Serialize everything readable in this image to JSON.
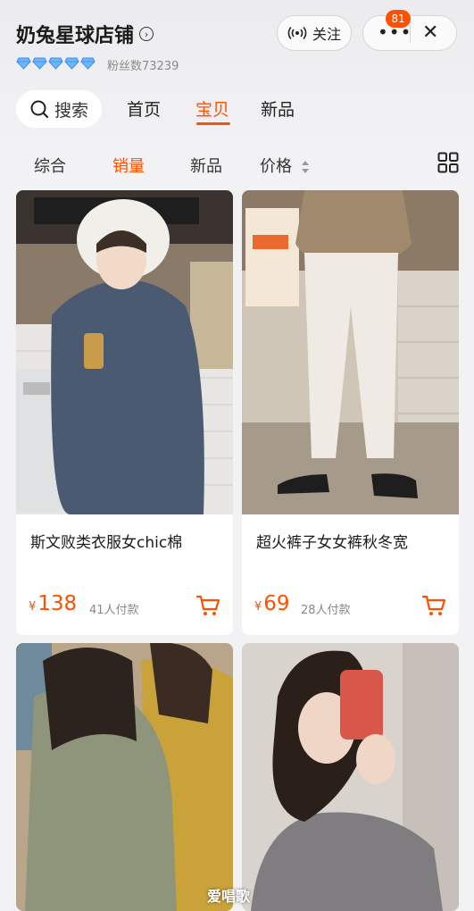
{
  "shop": {
    "name": "奶兔星球店铺",
    "diamond_count": 5,
    "fans_text": "粉丝数73239",
    "follow_label": "关注",
    "message_badge": "81"
  },
  "nav": {
    "search_label": "搜索",
    "tabs": [
      {
        "label": "首页",
        "active": false
      },
      {
        "label": "宝贝",
        "active": true
      },
      {
        "label": "新品",
        "active": false
      }
    ]
  },
  "sort": {
    "tabs": [
      {
        "label": "综合",
        "active": false
      },
      {
        "label": "销量",
        "active": true
      },
      {
        "label": "新品",
        "active": false
      },
      {
        "label": "价格",
        "active": false
      }
    ]
  },
  "products": [
    {
      "title": "斯文败类衣服女chic棉",
      "currency": "¥",
      "price": "138",
      "sold": "41人付款"
    },
    {
      "title": "超火裤子女女裤秋冬宽",
      "currency": "¥",
      "price": "69",
      "sold": "28人付款"
    },
    {
      "title": "",
      "currency": "",
      "price": "",
      "sold": ""
    },
    {
      "title": "",
      "currency": "",
      "price": "",
      "sold": ""
    }
  ],
  "watermark": "爱唱歌",
  "colors": {
    "accent": "#ff5000",
    "background": "#f2f2f4",
    "diamond": "#5aa7ff"
  }
}
